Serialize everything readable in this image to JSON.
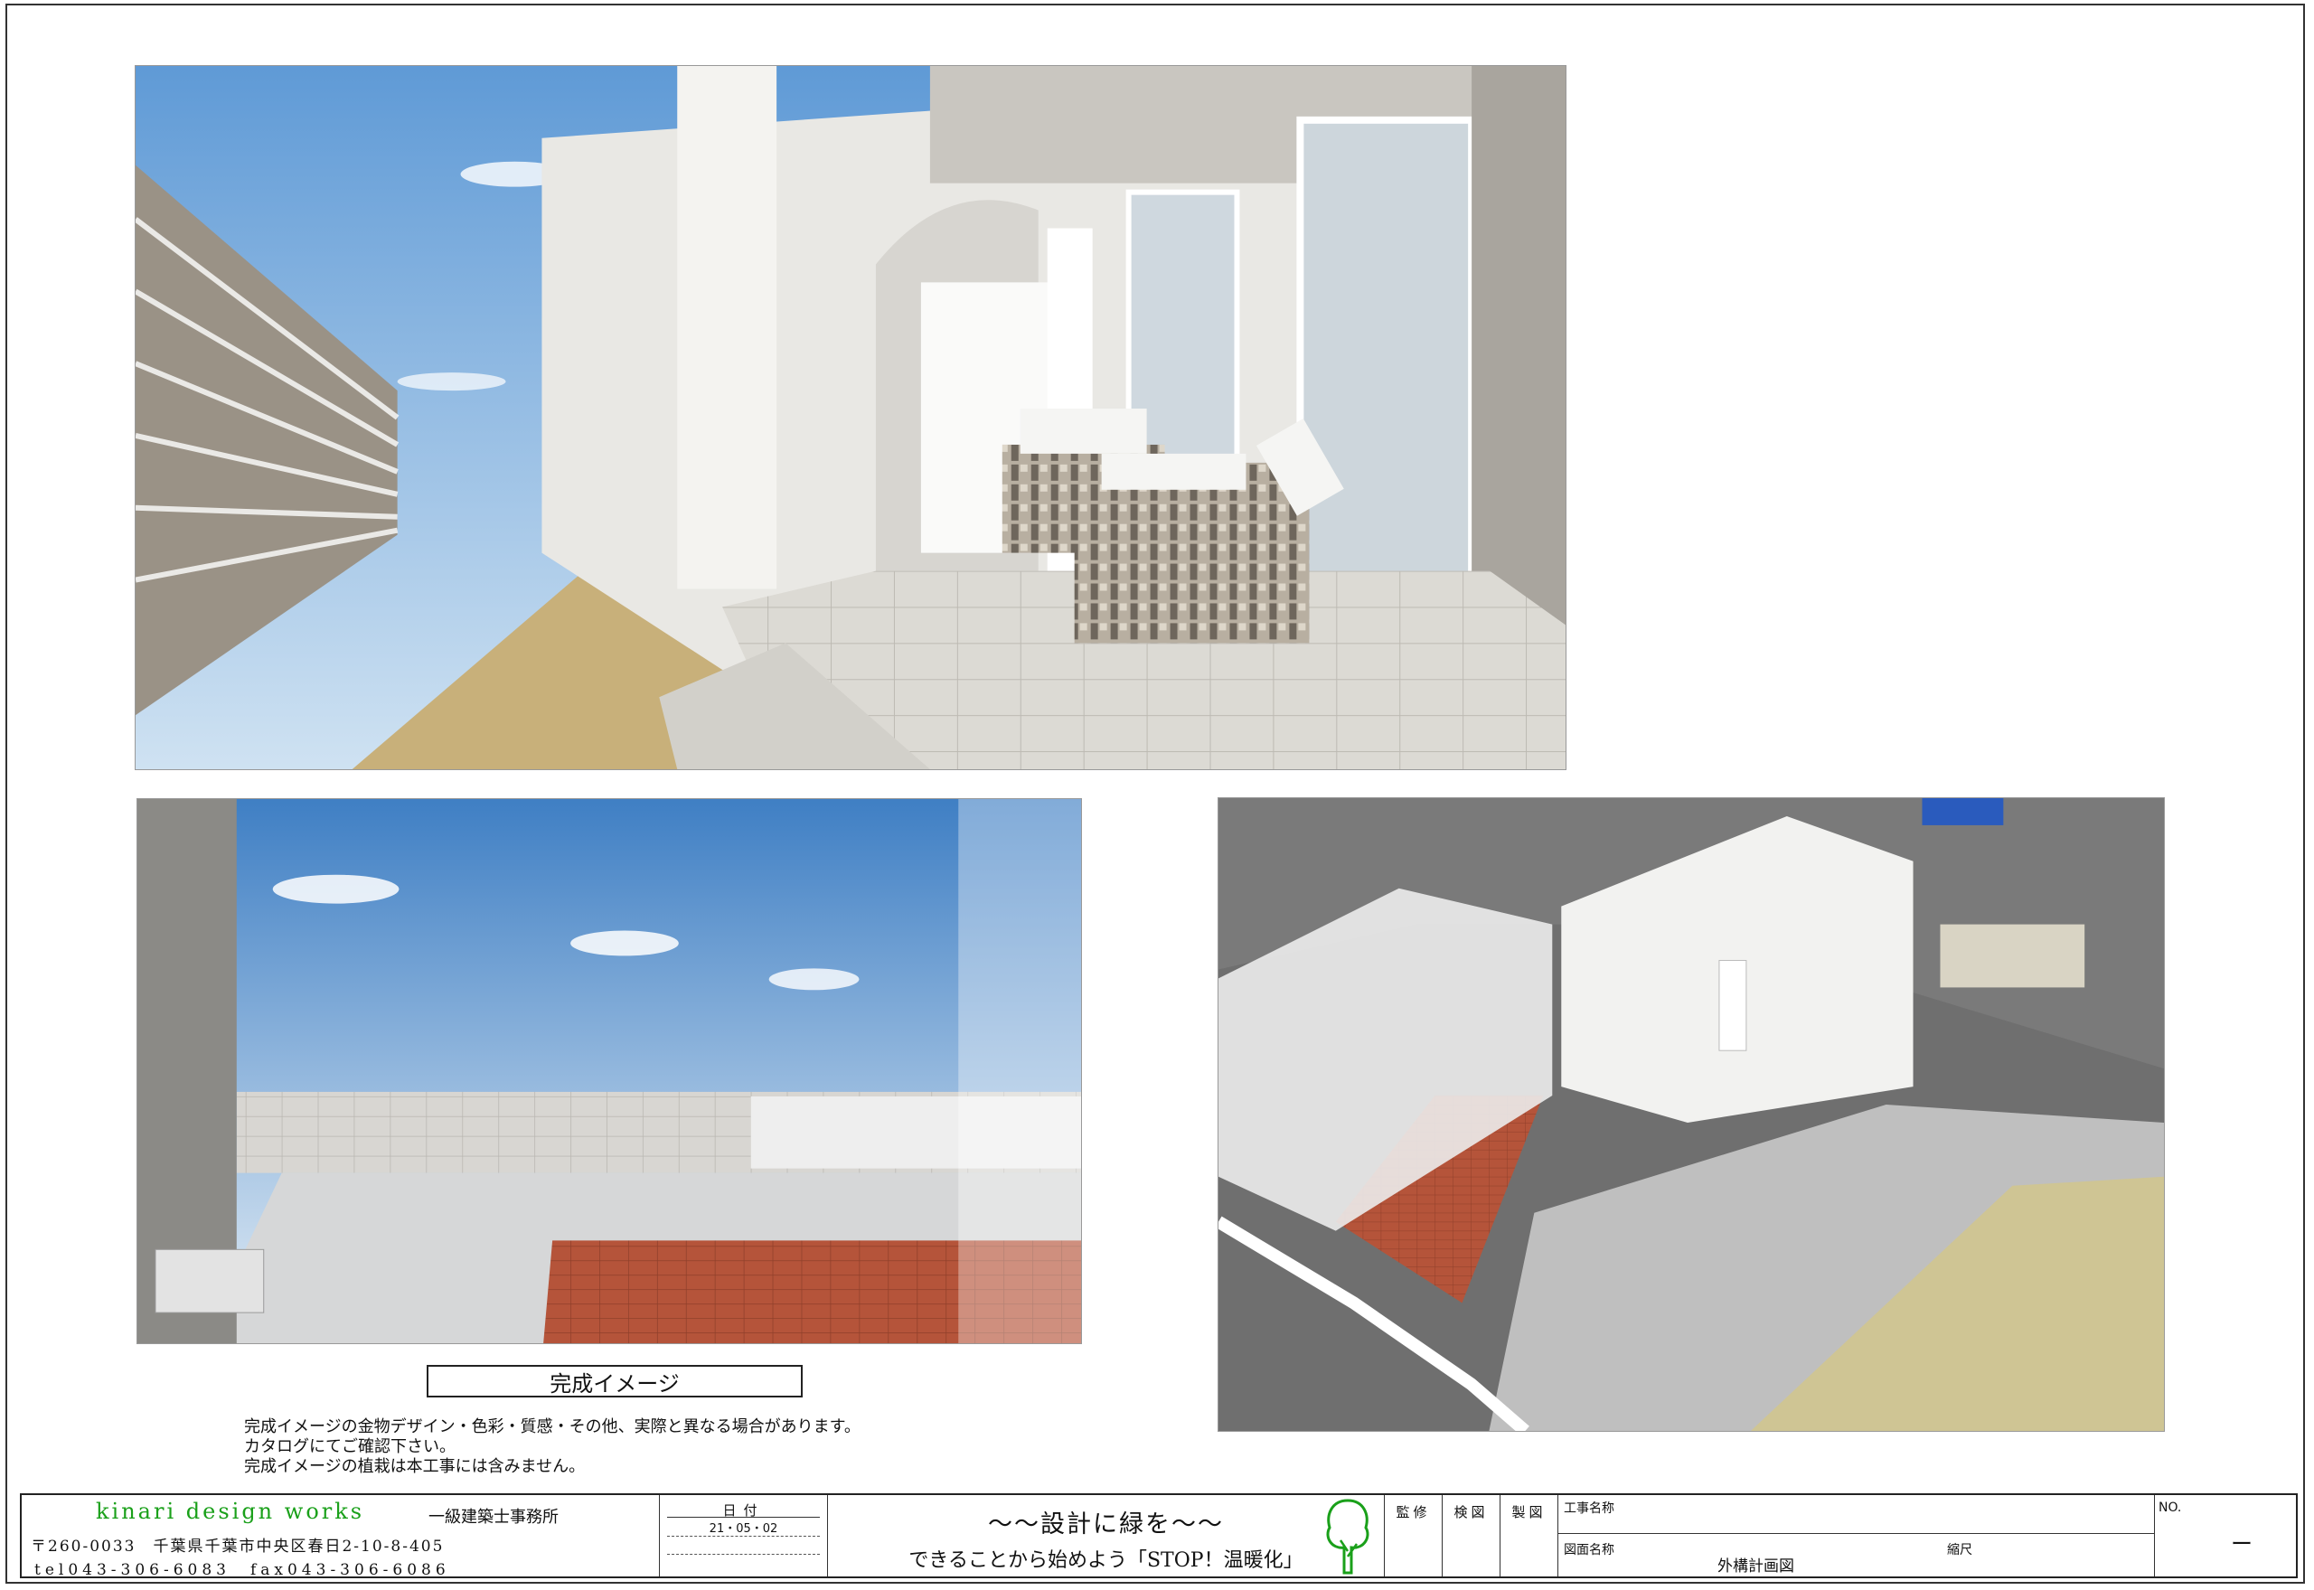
{
  "caption": {
    "title": "完成イメージ"
  },
  "notes": [
    "完成イメージの金物デザイン・色彩・質感・その他、実際と異なる場合があります。",
    "カタログにてご確認下さい。",
    "完成イメージの植栽は本工事には含みません。"
  ],
  "title_block": {
    "firm_name": "kinari design works",
    "firm_type": "一級建築士事務所",
    "address": "〒260-0033　千葉県千葉市中央区春日2-10-8-405",
    "phone": "tel043-306-6083　fax043-306-6086",
    "date_label": "日付",
    "date_value": "21・05・02",
    "slogan_main": "～～設計に緑を～～",
    "slogan_sub": "できることから始めよう「STOP！温暖化」",
    "supervision_label": "監修",
    "check_label": "検図",
    "drafting_label": "製図",
    "project_name_label": "工事名称",
    "drawing_name_label": "図面名称",
    "drawing_name": "外構計画図",
    "scale_label": "縮尺",
    "number_label": "NO.",
    "number_value": "ー"
  },
  "colors": {
    "logo_green": "#1aa01a",
    "brick": "#b5543a",
    "sky": "#7fb3e0",
    "gravel": "#c8b07a"
  },
  "icons": {
    "logo": "tree-icon"
  }
}
